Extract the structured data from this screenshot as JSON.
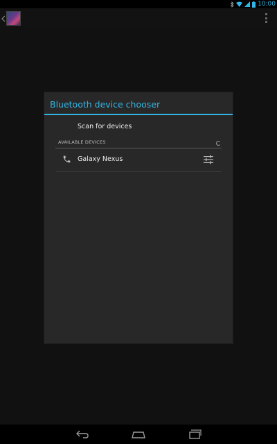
{
  "status_bar": {
    "time": "10:00",
    "icons": [
      "bluetooth-icon",
      "wifi-icon",
      "cell-signal-icon",
      "battery-icon"
    ]
  },
  "action_bar": {
    "icons": [
      "up-caret-icon",
      "app-icon",
      "overflow-menu-icon"
    ]
  },
  "dialog": {
    "title": "Bluetooth device chooser",
    "scan_label": "Scan for devices",
    "section_header": "AVAILABLE DEVICES",
    "devices": [
      {
        "name": "Galaxy Nexus",
        "icon": "phone-icon",
        "action_icon": "settings-icon"
      }
    ]
  },
  "nav_bar": {
    "icons": [
      "back-icon",
      "home-icon",
      "recent-apps-icon"
    ]
  },
  "colors": {
    "accent": "#33b5e5",
    "dialog_bg": "#282828",
    "background": "#111111"
  }
}
